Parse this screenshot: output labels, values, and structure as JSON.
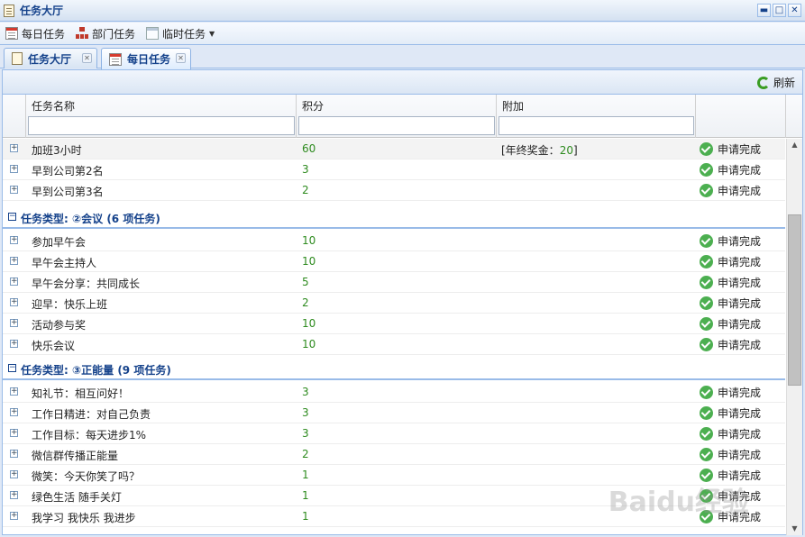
{
  "window": {
    "title": "任务大厅"
  },
  "window_buttons": {
    "minimize": "▬",
    "maximize": "□",
    "close": "✕"
  },
  "toolbar": {
    "items": [
      {
        "label": "每日任务",
        "icon": "calendar-icon"
      },
      {
        "label": "部门任务",
        "icon": "org-chart-icon"
      },
      {
        "label": "临时任务",
        "icon": "template-icon",
        "has_dropdown": true
      }
    ]
  },
  "tabs": [
    {
      "label": "任务大厅",
      "icon": "book-icon",
      "active": false
    },
    {
      "label": "每日任务",
      "icon": "calendar-icon",
      "active": true
    }
  ],
  "subtoolbar": {
    "refresh_label": "刷新"
  },
  "grid": {
    "columns": [
      "任务名称",
      "积分",
      "附加"
    ],
    "top_rows": [
      {
        "name": "加班3小时",
        "score": "60",
        "extra_prefix": "[年终奖金：",
        "extra_value": "20",
        "extra_suffix": "]",
        "action": "申请完成"
      },
      {
        "name": "早到公司第2名",
        "score": "3",
        "action": "申请完成"
      },
      {
        "name": "早到公司第3名",
        "score": "2",
        "action": "申请完成"
      }
    ],
    "groups": [
      {
        "label": "任务类型: ②会议 (6 项任务)",
        "rows": [
          {
            "name": "参加早午会",
            "score": "10",
            "action": "申请完成"
          },
          {
            "name": "早午会主持人",
            "score": "10",
            "action": "申请完成"
          },
          {
            "name": "早午会分享：共同成长",
            "score": "5",
            "action": "申请完成"
          },
          {
            "name": "迎早：快乐上班",
            "score": "2",
            "action": "申请完成"
          },
          {
            "name": "活动参与奖",
            "score": "10",
            "action": "申请完成"
          },
          {
            "name": "快乐会议",
            "score": "10",
            "action": "申请完成"
          }
        ]
      },
      {
        "label": "任务类型: ③正能量 (9 项任务)",
        "rows": [
          {
            "name": "知礼节：相互问好！",
            "score": "3",
            "action": "申请完成"
          },
          {
            "name": "工作日精进：对自己负责",
            "score": "3",
            "action": "申请完成"
          },
          {
            "name": "工作目标：每天进步1%",
            "score": "3",
            "action": "申请完成"
          },
          {
            "name": "微信群传播正能量",
            "score": "2",
            "action": "申请完成"
          },
          {
            "name": "微笑：今天你笑了吗？",
            "score": "1",
            "action": "申请完成"
          },
          {
            "name": "绿色生活 随手关灯",
            "score": "1",
            "action": "申请完成"
          },
          {
            "name": "我学习 我快乐 我进步",
            "score": "1",
            "action": "申请完成"
          }
        ]
      }
    ]
  },
  "watermark": "Baidu经验"
}
